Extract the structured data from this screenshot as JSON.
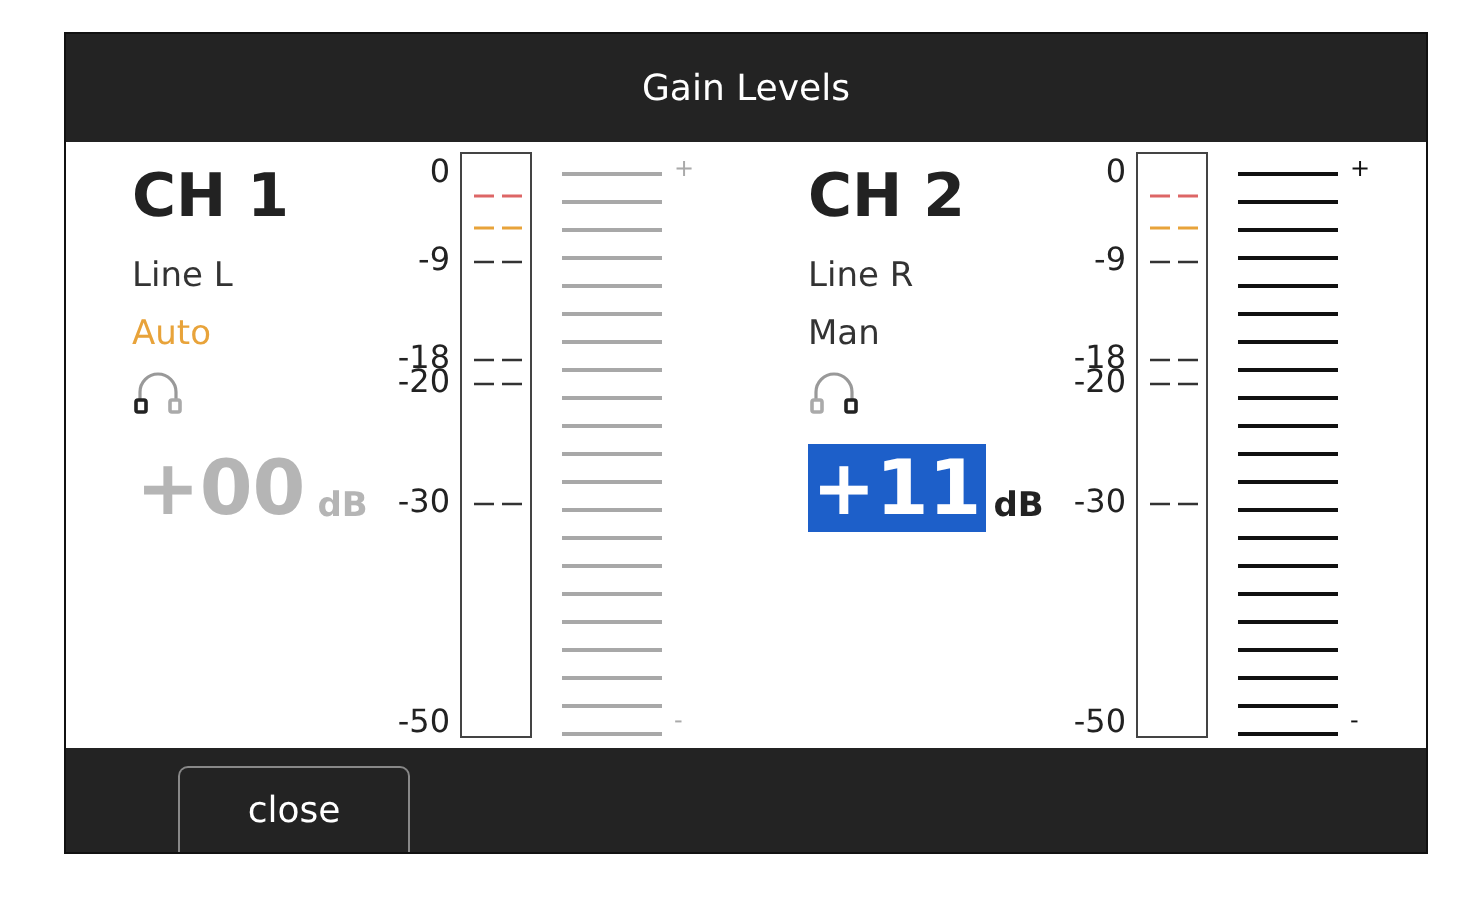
{
  "window": {
    "title": "Gain Levels"
  },
  "channels": [
    {
      "name": "CH 1",
      "input": "Line L",
      "mode": "Auto",
      "auto": true,
      "headphone_left": true,
      "headphone_right": false,
      "gain": "+00",
      "unit": "dB",
      "selected": false,
      "meter": {
        "scale": [
          "0",
          "-9",
          "-18",
          "-20",
          "-30",
          "-50"
        ],
        "plus": "+",
        "minus": "-"
      }
    },
    {
      "name": "CH 2",
      "input": "Line R",
      "mode": "Man",
      "auto": false,
      "headphone_left": false,
      "headphone_right": true,
      "gain": "+11",
      "unit": "dB",
      "selected": true,
      "meter": {
        "scale": [
          "0",
          "-9",
          "-18",
          "-20",
          "-30",
          "-50"
        ],
        "plus": "+",
        "minus": "-"
      }
    }
  ],
  "footer": {
    "buttons": [
      "close"
    ]
  }
}
